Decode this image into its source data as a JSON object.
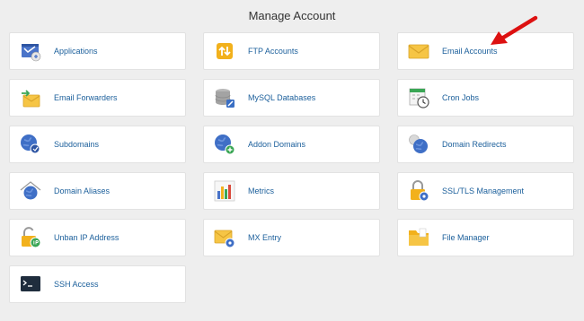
{
  "page": {
    "title": "Manage Account"
  },
  "tiles": [
    {
      "label": "Applications"
    },
    {
      "label": "FTP Accounts"
    },
    {
      "label": "Email Accounts"
    },
    {
      "label": "Email Forwarders"
    },
    {
      "label": "MySQL Databases"
    },
    {
      "label": "Cron Jobs"
    },
    {
      "label": "Subdomains"
    },
    {
      "label": "Addon Domains"
    },
    {
      "label": "Domain Redirects"
    },
    {
      "label": "Domain Aliases"
    },
    {
      "label": "Metrics"
    },
    {
      "label": "SSL/TLS Management"
    },
    {
      "label": "Unban IP Address"
    },
    {
      "label": "MX Entry"
    },
    {
      "label": "File Manager"
    },
    {
      "label": "SSH Access"
    }
  ],
  "icons": [
    "applications-icon",
    "ftp-accounts-icon",
    "email-accounts-icon",
    "email-forwarders-icon",
    "mysql-databases-icon",
    "cron-jobs-icon",
    "subdomains-icon",
    "addon-domains-icon",
    "domain-redirects-icon",
    "domain-aliases-icon",
    "metrics-icon",
    "ssl-tls-icon",
    "unban-ip-icon",
    "mx-entry-icon",
    "file-manager-icon",
    "ssh-access-icon"
  ],
  "colors": {
    "page_bg": "#eeeeee",
    "tile_bg": "#ffffff",
    "link": "#1b5f9b",
    "annotation_arrow": "#dd1111"
  }
}
